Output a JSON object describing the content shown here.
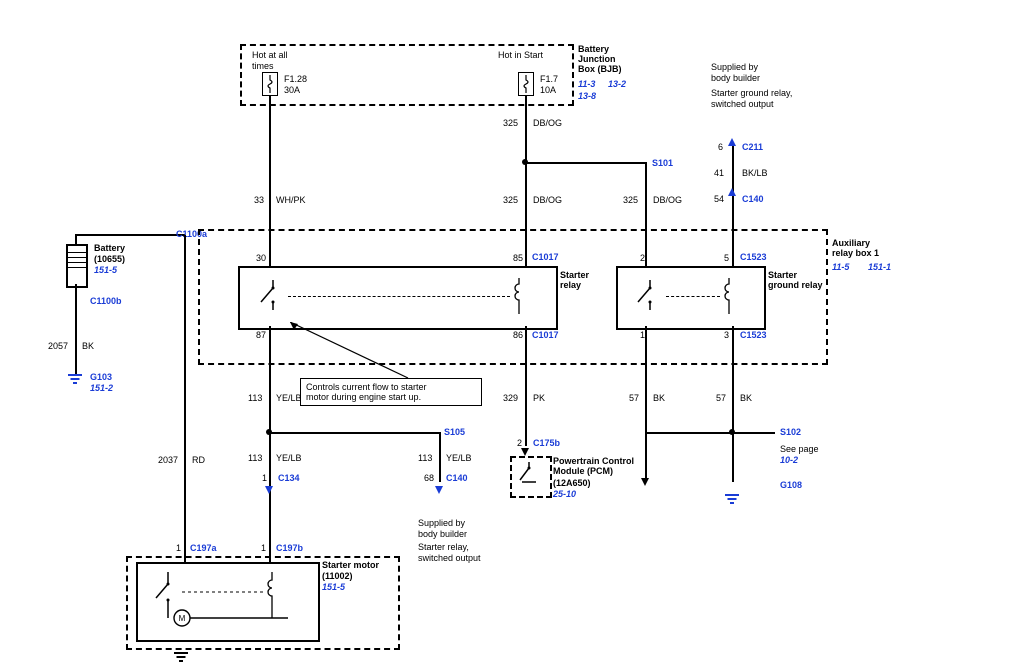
{
  "bjb": {
    "hot_all": "Hot at all\ntimes",
    "hot_start": "Hot in Start",
    "f128": "F1.28",
    "f128a": "30A",
    "f17": "F1.7",
    "f17a": "10A",
    "title": "Battery\nJunction\nBox (BJB)",
    "ref1": "11-3",
    "ref2": "13-2",
    "ref3": "13-8"
  },
  "wires": {
    "w33": "33",
    "w33c": "WH/PK",
    "w325": "325",
    "w325c": "DB/OG",
    "w2057": "2057",
    "w2057c": "BK",
    "w2037": "2037",
    "w2037c": "RD",
    "w113": "113",
    "w113c": "YE/LB",
    "w329": "329",
    "w329c": "PK",
    "w57": "57",
    "w57c": "BK",
    "w6": "6",
    "w41": "41",
    "w41c": "BK/LB",
    "w54": "54",
    "w68": "68",
    "w1": "1",
    "w2": "2",
    "w3": "3",
    "w5": "5",
    "w30": "30",
    "w85": "85",
    "w86": "86",
    "w87": "87"
  },
  "conns": {
    "c1100a": "C1100a",
    "c1100b": "C1100b",
    "c1017": "C1017",
    "c1523": "C1523",
    "c211": "C211",
    "c140": "C140",
    "c134": "C134",
    "c197a": "C197a",
    "c197b": "C197b",
    "c175b": "C175b"
  },
  "splices": {
    "s101": "S101",
    "s105": "S105",
    "s102": "S102"
  },
  "grounds": {
    "g103": "G103",
    "g103r": "151-2",
    "g108": "G108"
  },
  "battery": {
    "label": "Battery",
    "part": "(10655)",
    "ref": "151-5"
  },
  "aux": {
    "title": "Auxiliary\nrelay box 1",
    "ref1": "11-5",
    "ref2": "151-1",
    "starter_relay": "Starter\nrelay",
    "ground_relay": "Starter\nground relay"
  },
  "starter_motor": {
    "label": "Starter motor",
    "part": "(11002)",
    "ref": "151-5"
  },
  "pcm": {
    "label": "Powertrain Control\nModule (PCM)",
    "part": "(12A650)",
    "ref": "25-10"
  },
  "notes": {
    "supplied": "Supplied by\nbody builder",
    "sgr_switched": "Starter ground relay,\nswitched output",
    "sr_switched": "Starter relay,\nswitched output",
    "seepage": "See page",
    "pg102": "10-2",
    "control": "Controls current flow to starter\nmotor during engine start up."
  }
}
